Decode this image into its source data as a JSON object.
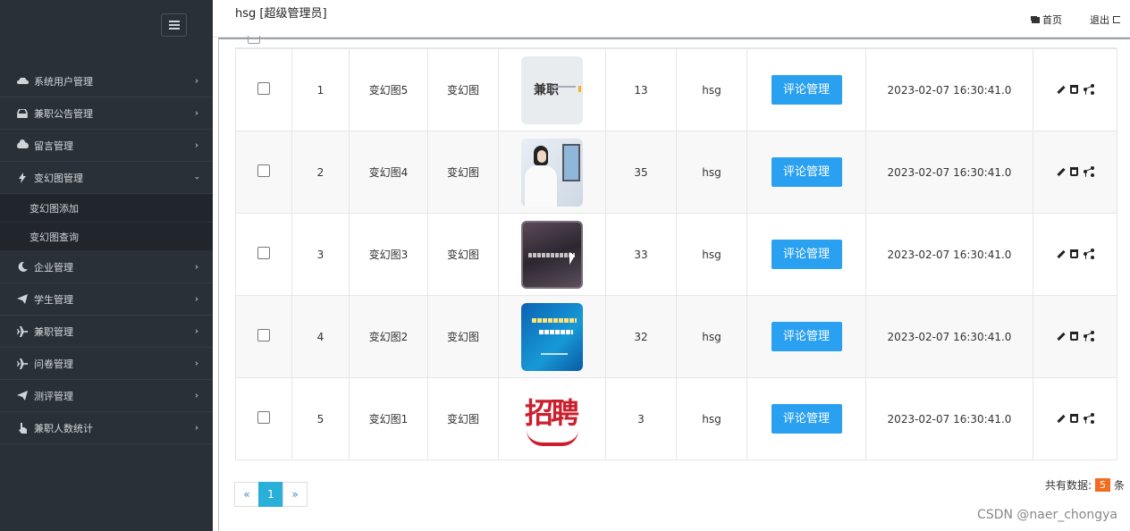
{
  "header": {
    "user": "hsg [超级管理员]",
    "home_label": "首页",
    "logout_label": "退出"
  },
  "sidebar": {
    "items": [
      {
        "label": "系统用户管理",
        "icon": "car-icon"
      },
      {
        "label": "兼职公告管理",
        "icon": "inbox-icon"
      },
      {
        "label": "留言管理",
        "icon": "cloud-icon"
      },
      {
        "label": "变幻图管理",
        "icon": "bolt-icon",
        "expanded": true
      },
      {
        "label": "企业管理",
        "icon": "moon-icon"
      },
      {
        "label": "学生管理",
        "icon": "send-icon"
      },
      {
        "label": "兼职管理",
        "icon": "plane-icon"
      },
      {
        "label": "问卷管理",
        "icon": "plane-icon"
      },
      {
        "label": "测评管理",
        "icon": "send-icon"
      },
      {
        "label": "兼职人数统计",
        "icon": "hand-icon"
      }
    ],
    "submenu": [
      {
        "label": "变幻图添加"
      },
      {
        "label": "变幻图查询"
      }
    ]
  },
  "table": {
    "rows": [
      {
        "index": "1",
        "name": "变幻图5",
        "type": "变幻图",
        "thumb": "thumb-jianzhi",
        "count": "13",
        "user": "hsg",
        "action": "评论管理",
        "time": "2023-02-07 16:30:41.0"
      },
      {
        "index": "2",
        "name": "变幻图4",
        "type": "变幻图",
        "thumb": "thumb-woman-phone",
        "count": "35",
        "user": "hsg",
        "action": "评论管理",
        "time": "2023-02-07 16:30:41.0"
      },
      {
        "index": "3",
        "name": "变幻图3",
        "type": "变幻图",
        "thumb": "thumb-dark-slide",
        "count": "33",
        "user": "hsg",
        "action": "评论管理",
        "time": "2023-02-07 16:30:41.0"
      },
      {
        "index": "4",
        "name": "变幻图2",
        "type": "变幻图",
        "thumb": "thumb-blue-poster",
        "count": "32",
        "user": "hsg",
        "action": "评论管理",
        "time": "2023-02-07 16:30:41.0"
      },
      {
        "index": "5",
        "name": "变幻图1",
        "type": "变幻图",
        "thumb": "thumb-zhaopin",
        "count": "3",
        "user": "hsg",
        "action": "评论管理",
        "time": "2023-02-07 16:30:41.0"
      }
    ]
  },
  "pagination": {
    "prev": "«",
    "current": "1",
    "next": "»"
  },
  "summary": {
    "prefix": "共有数据:",
    "count": "5",
    "suffix": "条"
  },
  "watermark": "CSDN @naer_chongya",
  "colors": {
    "sidebar_bg": "#2a3038",
    "button_blue": "#2aa0f0",
    "page_active": "#2ab0d8",
    "count_badge": "#f26d21"
  }
}
